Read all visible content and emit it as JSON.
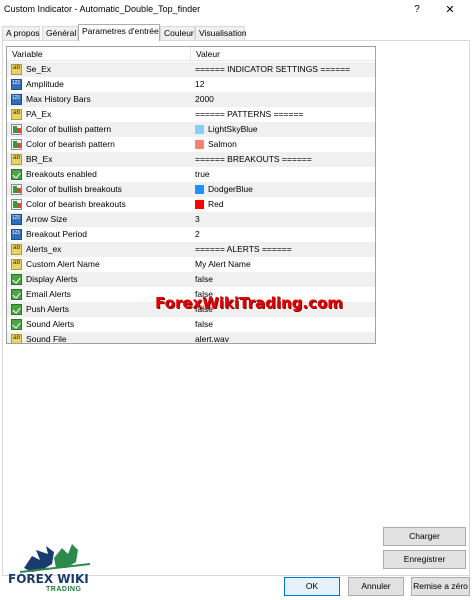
{
  "window": {
    "title": "Custom Indicator - Automatic_Double_Top_finder",
    "help_label": "?",
    "close_label": "✕"
  },
  "tabs": [
    {
      "label": "A propos",
      "active": false
    },
    {
      "label": "Général",
      "active": false
    },
    {
      "label": "Parametres d'entrée",
      "active": true
    },
    {
      "label": "Couleur",
      "active": false
    },
    {
      "label": "Visualisation",
      "active": false
    }
  ],
  "grid": {
    "headers": {
      "variable": "Variable",
      "value": "Valeur"
    },
    "rows": [
      {
        "icon": "ab",
        "name": "Se_Ex",
        "value": "====== INDICATOR SETTINGS ======"
      },
      {
        "icon": "num",
        "name": "Amplitude",
        "value": "12"
      },
      {
        "icon": "num",
        "name": "Max History Bars",
        "value": "2000"
      },
      {
        "icon": "ab",
        "name": "PA_Ex",
        "value": "====== PATTERNS ======"
      },
      {
        "icon": "color",
        "name": "Color of bullish pattern",
        "value": "LightSkyBlue",
        "swatch": "#87cefa"
      },
      {
        "icon": "color",
        "name": "Color of bearish pattern",
        "value": "Salmon",
        "swatch": "#fa8072"
      },
      {
        "icon": "ab",
        "name": "BR_Ex",
        "value": "====== BREAKOUTS ======"
      },
      {
        "icon": "bool",
        "name": "Breakouts enabled",
        "value": "true"
      },
      {
        "icon": "color",
        "name": "Color of bullish breakouts",
        "value": "DodgerBlue",
        "swatch": "#1e90ff"
      },
      {
        "icon": "color",
        "name": "Color of bearish breakouts",
        "value": "Red",
        "swatch": "#ff0000"
      },
      {
        "icon": "num",
        "name": "Arrow Size",
        "value": "3"
      },
      {
        "icon": "num",
        "name": "Breakout Period",
        "value": "2"
      },
      {
        "icon": "ab",
        "name": "Alerts_ex",
        "value": "====== ALERTS ======"
      },
      {
        "icon": "ab",
        "name": "Custom Alert Name",
        "value": "My Alert Name"
      },
      {
        "icon": "bool",
        "name": "Display Alerts",
        "value": "false"
      },
      {
        "icon": "bool",
        "name": "Email Alerts",
        "value": "false"
      },
      {
        "icon": "bool",
        "name": "Push Alerts",
        "value": "false"
      },
      {
        "icon": "bool",
        "name": "Sound Alerts",
        "value": "false"
      },
      {
        "icon": "ab",
        "name": "Sound File",
        "value": "alert.wav"
      }
    ]
  },
  "watermark": "ForexWikiTrading.com",
  "side_buttons": {
    "load": "Charger",
    "save": "Enregistrer"
  },
  "footer_buttons": {
    "ok": "OK",
    "cancel": "Annuler",
    "reset": "Remise a zéro"
  },
  "logo": {
    "main": "FOREX WIKI",
    "sub": "TRADING"
  }
}
